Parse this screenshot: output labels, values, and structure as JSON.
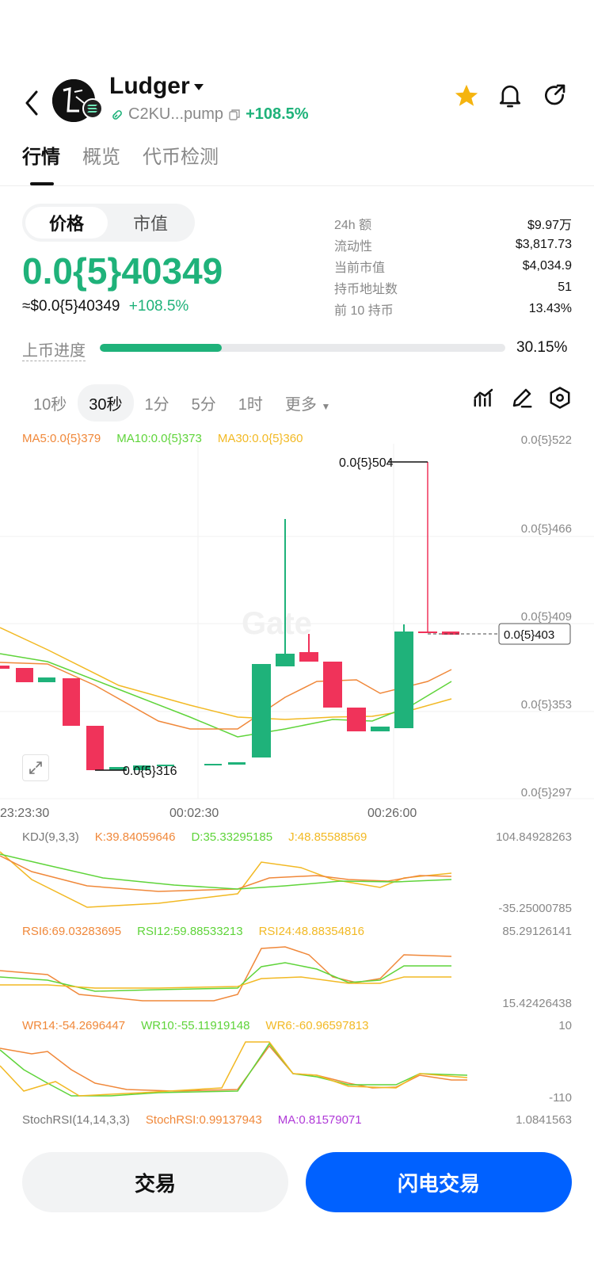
{
  "header": {
    "token_name": "Ludger",
    "contract": "C2KU...pump",
    "change": "+108.5%"
  },
  "tabs": [
    "行情",
    "概览",
    "代币检测"
  ],
  "price_toggle": [
    "价格",
    "市值"
  ],
  "price": {
    "main": "0.0{5}40349",
    "usd": "≈$0.0{5}40349",
    "change": "+108.5%"
  },
  "stats": [
    {
      "k": "24h  额",
      "v": "$9.97万"
    },
    {
      "k": "流动性",
      "v": "$3,817.73"
    },
    {
      "k": "当前市值",
      "v": "$4,034.9"
    },
    {
      "k": "持币地址数",
      "v": "51"
    },
    {
      "k": "前 10 持币",
      "v": "13.43%"
    }
  ],
  "progress": {
    "label": "上币进度",
    "value": "30.15%",
    "fraction": 0.3015
  },
  "intervals": [
    "10秒",
    "30秒",
    "1分",
    "5分",
    "1时",
    "更多"
  ],
  "ma": {
    "ma5": "MA5:0.0{5}379",
    "ma10": "MA10:0.0{5}373",
    "ma30": "MA30:0.0{5}360"
  },
  "price_axis": [
    "0.0{5}522",
    "0.0{5}466",
    "0.0{5}409",
    "0.0{5}353",
    "0.0{5}297"
  ],
  "chart_labels": {
    "high": "0.0{5}504",
    "low": "0.0{5}316",
    "current": "0.0{5}403"
  },
  "time_axis": [
    "23:23:30",
    "00:02:30",
    "00:26:00"
  ],
  "kdj": {
    "name": "KDJ(9,3,3)",
    "k": "K:39.84059646",
    "d": "D:35.33295185",
    "j": "J:48.85588569",
    "max": "104.84928263",
    "min": "-35.25000785"
  },
  "rsi": {
    "r6": "RSI6:69.03283695",
    "r12": "RSI12:59.88533213",
    "r24": "RSI24:48.88354816",
    "max": "85.29126141",
    "min": "15.42426438"
  },
  "wr": {
    "w14": "WR14:-54.2696447",
    "w10": "WR10:-55.11919148",
    "w6": "WR6:-60.96597813",
    "max": "10",
    "min": "-110"
  },
  "stoch": {
    "name": "StochRSI(14,14,3,3)",
    "val": "StochRSI:0.99137943",
    "ma": "MA:0.81579071",
    "max": "1.0841563"
  },
  "buttons": {
    "trade": "交易",
    "flash": "闪电交易"
  },
  "watermark": "Gate",
  "colors": {
    "green": "#1fb27a",
    "red": "#f0335a",
    "blue": "#0061ff",
    "star": "#f5b40f"
  }
}
